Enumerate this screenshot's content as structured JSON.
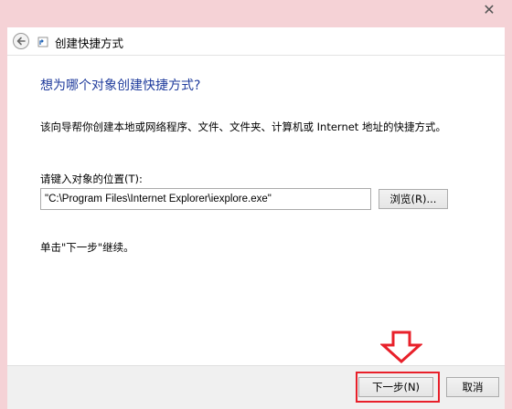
{
  "window": {
    "close_glyph": "✕"
  },
  "header": {
    "title": "创建快捷方式"
  },
  "page": {
    "heading": "想为哪个对象创建快捷方式?",
    "description": "该向导帮你创建本地或网络程序、文件、文件夹、计算机或 Internet 地址的快捷方式。",
    "location_label": "请键入对象的位置(T):",
    "location_value": "\"C:\\Program Files\\Internet Explorer\\iexplore.exe\"",
    "browse_label": "浏览(R)...",
    "hint": "单击\"下一步\"继续。"
  },
  "footer": {
    "next_label": "下一步(N)",
    "cancel_label": "取消"
  },
  "colors": {
    "heading": "#1f3b9c",
    "annotation": "#e8202a",
    "frame": "#f5d2d6"
  }
}
